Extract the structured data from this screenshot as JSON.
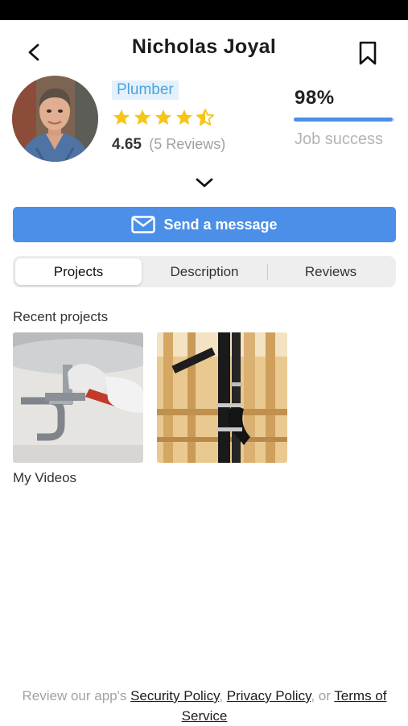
{
  "profile": {
    "name": "Nicholas Joyal",
    "profession": "Plumber",
    "rating": "4.65",
    "reviews_text": "(5 Reviews)",
    "stars": 4.5
  },
  "stats": {
    "job_success_value": "98%",
    "job_success_label": "Job success",
    "job_success_fraction": 0.98
  },
  "actions": {
    "send_message_label": "Send a message"
  },
  "tabs": [
    {
      "label": "Projects",
      "active": true
    },
    {
      "label": "Description",
      "active": false
    },
    {
      "label": "Reviews",
      "active": false
    }
  ],
  "sections": {
    "recent_projects": "Recent projects",
    "my_videos": "My Videos"
  },
  "footer": {
    "prefix": "Review our app's ",
    "security_policy": "Security Policy",
    "comma": ", ",
    "privacy_policy": "Privacy Policy",
    "or": ", or ",
    "terms": "Terms of Service"
  },
  "colors": {
    "accent": "#4c8fe8",
    "star": "#f5c518",
    "badge_bg": "#e4f1fb",
    "badge_text": "#4ba3df"
  }
}
